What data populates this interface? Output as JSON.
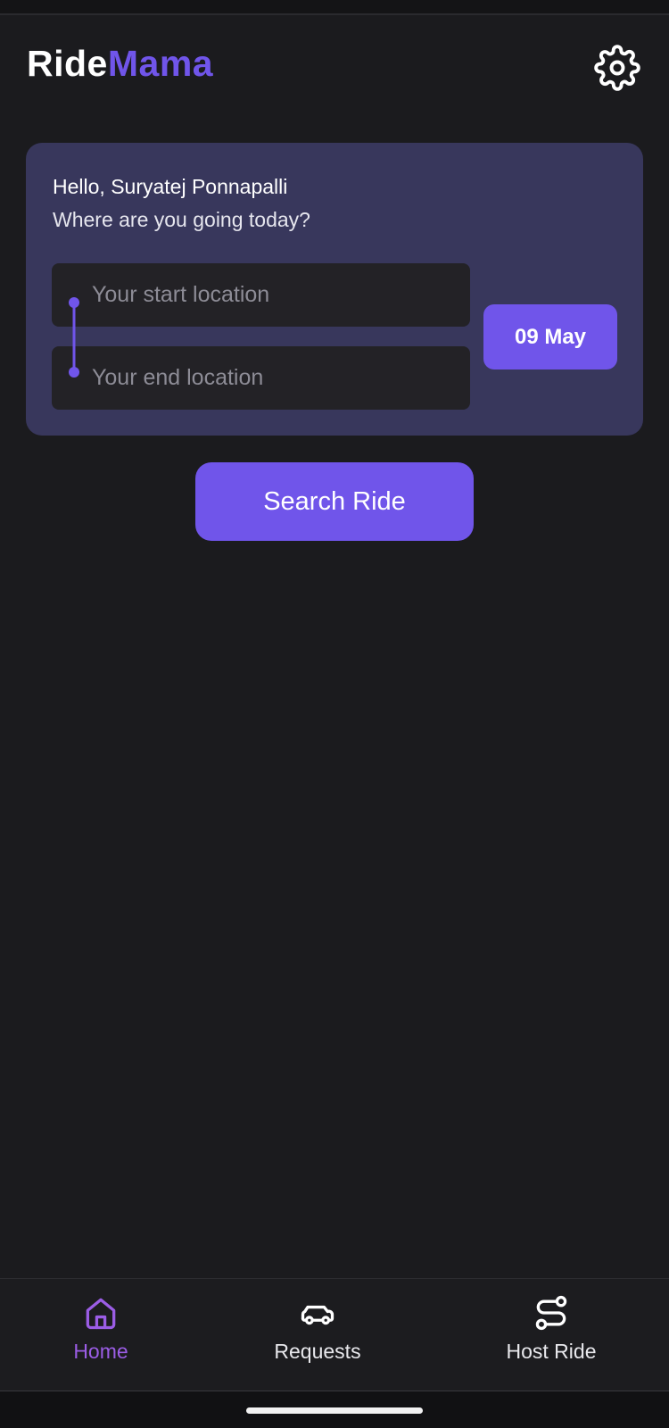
{
  "header": {
    "logo_part1": "Ride",
    "logo_part2": "Mama",
    "settings_icon": "gear-icon"
  },
  "search_card": {
    "greeting": "Hello, Suryatej Ponnapalli",
    "subtitle": "Where are you going today?",
    "start_location": {
      "value": "",
      "placeholder": "Your start location"
    },
    "end_location": {
      "value": "",
      "placeholder": "Your end location"
    },
    "date_label": "09 May"
  },
  "search_button_label": "Search Ride",
  "bottom_nav": {
    "items": [
      {
        "label": "Home",
        "icon": "home-icon",
        "active": true
      },
      {
        "label": "Requests",
        "icon": "car-icon",
        "active": false
      },
      {
        "label": "Host Ride",
        "icon": "route-icon",
        "active": false
      }
    ]
  },
  "colors": {
    "background": "#1b1b1e",
    "accent": "#7055ea",
    "card": "#38375c",
    "input": "#232226",
    "active_nav": "#9b5de5"
  }
}
